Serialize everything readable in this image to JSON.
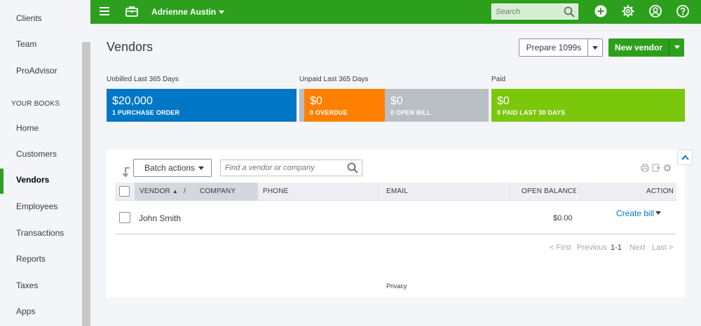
{
  "sidebar": {
    "items_top": [
      {
        "label": "Clients"
      },
      {
        "label": "Team"
      },
      {
        "label": "ProAdvisor"
      }
    ],
    "section_heading": "YOUR BOOKS",
    "items": [
      {
        "label": "Home"
      },
      {
        "label": "Customers"
      },
      {
        "label": "Vendors"
      },
      {
        "label": "Employees"
      },
      {
        "label": "Transactions"
      },
      {
        "label": "Reports"
      },
      {
        "label": "Taxes"
      },
      {
        "label": "Apps"
      }
    ],
    "active": "Vendors"
  },
  "topbar": {
    "company_name": "Adrienne Austin",
    "search_placeholder": "Search",
    "icons": [
      "menu-icon",
      "briefcase-icon",
      "search-icon",
      "plus-icon",
      "gear-icon",
      "user-icon",
      "help-icon"
    ]
  },
  "page": {
    "title": "Vendors",
    "prepare_button": "Prepare 1099s",
    "new_button": "New vendor"
  },
  "money_bar": {
    "unbilled_label": "Unbilled Last 365 Days",
    "unpaid_label": "Unpaid Last 365 Days",
    "paid_label": "Paid",
    "segments": [
      {
        "amount": "$20,000",
        "caption": "1 PURCHASE ORDER",
        "color": "#0077c5"
      },
      {
        "amount": "$0",
        "caption": "0 OVERDUE",
        "color": "#ff8000"
      },
      {
        "amount": "$0",
        "caption": "0 OPEN BILL",
        "color": "#babec5"
      },
      {
        "amount": "$0",
        "caption": "0 PAID LAST 30 DAYS",
        "color": "#7ac70c"
      }
    ]
  },
  "table": {
    "batch_actions": "Batch actions",
    "find_placeholder": "Find a vendor or company",
    "columns": {
      "vendor": "VENDOR",
      "separator": "/",
      "company": "COMPANY",
      "phone": "PHONE",
      "email": "EMAIL",
      "open_balance": "OPEN BALANCE",
      "action": "ACTION"
    },
    "rows": [
      {
        "vendor": "John Smith",
        "phone": "",
        "email": "",
        "open_balance": "$0.00",
        "action": "Create bill"
      }
    ],
    "pagination": {
      "first": "< First",
      "previous": "Previous",
      "range": "1-1",
      "next": "Next",
      "last": "Last >"
    }
  },
  "footer": {
    "privacy": "Privacy"
  },
  "colors": {
    "brand_green": "#2ca01c",
    "link_blue": "#0077c5"
  }
}
